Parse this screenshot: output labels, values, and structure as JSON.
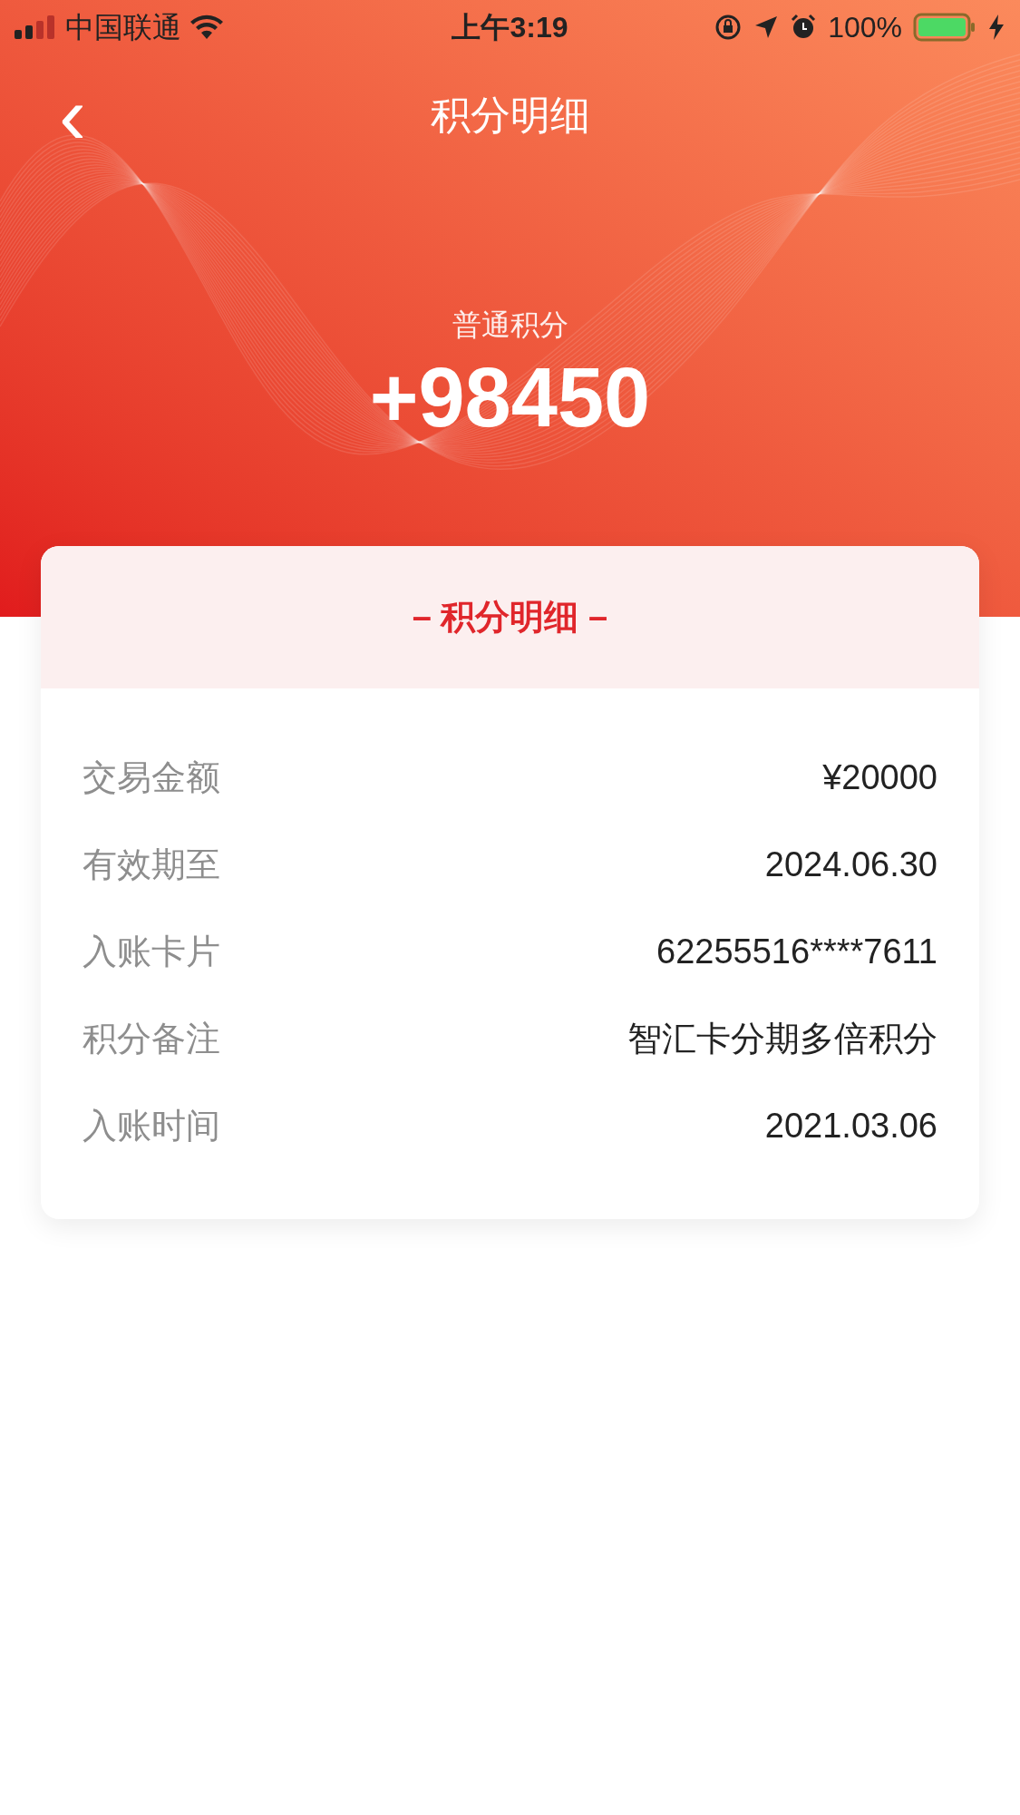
{
  "status_bar": {
    "carrier": "中国联通",
    "time": "上午3:19",
    "battery": "100%"
  },
  "nav": {
    "back": "‹",
    "title": "积分明细"
  },
  "points": {
    "label": "普通积分",
    "value": "+98450"
  },
  "card": {
    "title": "– 积分明细 –",
    "rows": [
      {
        "label": "交易金额",
        "value": "¥20000"
      },
      {
        "label": "有效期至",
        "value": "2024.06.30"
      },
      {
        "label": "入账卡片",
        "value": "62255516****7611"
      },
      {
        "label": "积分备注",
        "value": "智汇卡分期多倍积分"
      },
      {
        "label": "入账时间",
        "value": "2021.03.06"
      }
    ]
  }
}
